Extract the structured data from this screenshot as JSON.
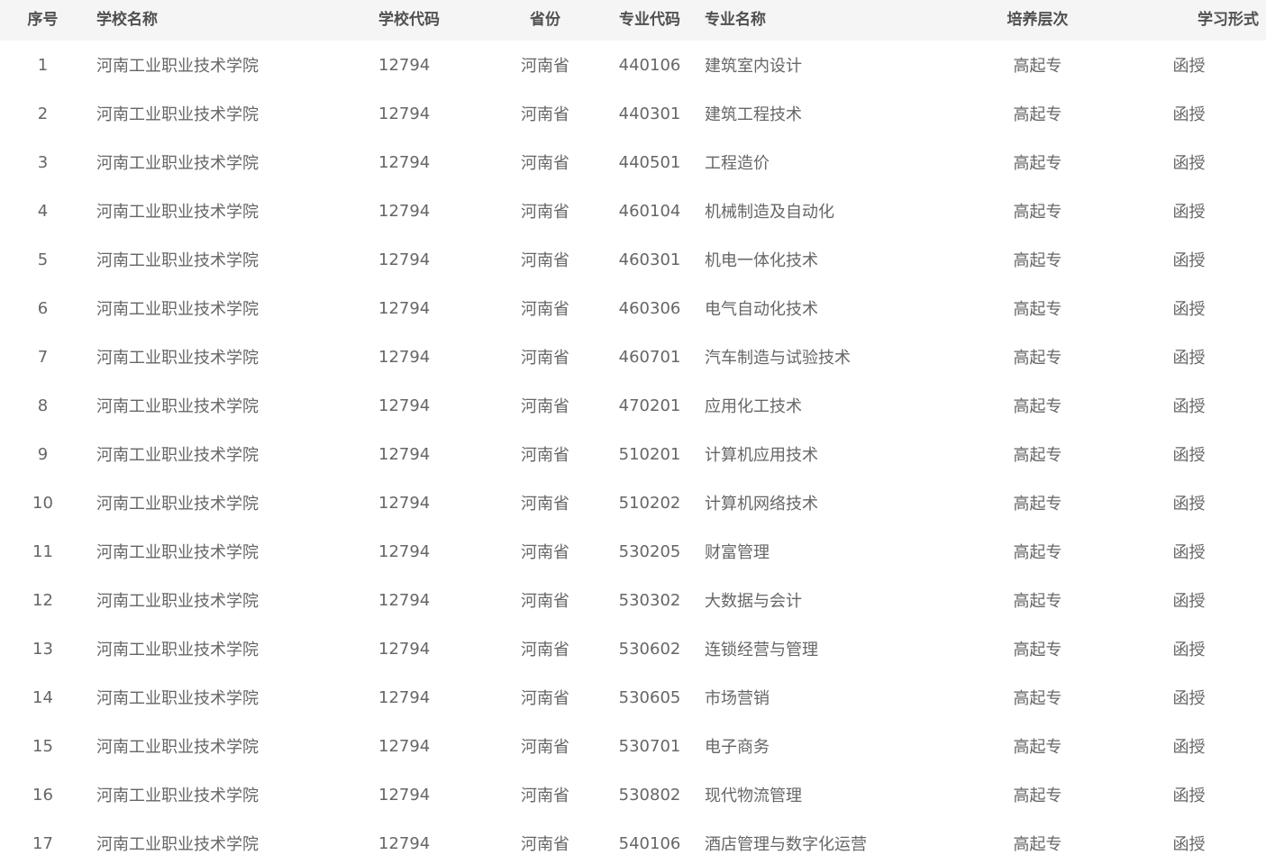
{
  "table": {
    "headers": {
      "index": "序号",
      "school_name": "学校名称",
      "school_code": "学校代码",
      "province": "省份",
      "major_code": "专业代码",
      "major_name": "专业名称",
      "level": "培养层次",
      "study_form": "学习形式"
    },
    "rows": [
      {
        "index": "1",
        "school_name": "河南工业职业技术学院",
        "school_code": "12794",
        "province": "河南省",
        "major_code": "440106",
        "major_name": "建筑室内设计",
        "level": "高起专",
        "study_form": "函授"
      },
      {
        "index": "2",
        "school_name": "河南工业职业技术学院",
        "school_code": "12794",
        "province": "河南省",
        "major_code": "440301",
        "major_name": "建筑工程技术",
        "level": "高起专",
        "study_form": "函授"
      },
      {
        "index": "3",
        "school_name": "河南工业职业技术学院",
        "school_code": "12794",
        "province": "河南省",
        "major_code": "440501",
        "major_name": "工程造价",
        "level": "高起专",
        "study_form": "函授"
      },
      {
        "index": "4",
        "school_name": "河南工业职业技术学院",
        "school_code": "12794",
        "province": "河南省",
        "major_code": "460104",
        "major_name": "机械制造及自动化",
        "level": "高起专",
        "study_form": "函授"
      },
      {
        "index": "5",
        "school_name": "河南工业职业技术学院",
        "school_code": "12794",
        "province": "河南省",
        "major_code": "460301",
        "major_name": "机电一体化技术",
        "level": "高起专",
        "study_form": "函授"
      },
      {
        "index": "6",
        "school_name": "河南工业职业技术学院",
        "school_code": "12794",
        "province": "河南省",
        "major_code": "460306",
        "major_name": "电气自动化技术",
        "level": "高起专",
        "study_form": "函授"
      },
      {
        "index": "7",
        "school_name": "河南工业职业技术学院",
        "school_code": "12794",
        "province": "河南省",
        "major_code": "460701",
        "major_name": "汽车制造与试验技术",
        "level": "高起专",
        "study_form": "函授"
      },
      {
        "index": "8",
        "school_name": "河南工业职业技术学院",
        "school_code": "12794",
        "province": "河南省",
        "major_code": "470201",
        "major_name": "应用化工技术",
        "level": "高起专",
        "study_form": "函授"
      },
      {
        "index": "9",
        "school_name": "河南工业职业技术学院",
        "school_code": "12794",
        "province": "河南省",
        "major_code": "510201",
        "major_name": "计算机应用技术",
        "level": "高起专",
        "study_form": "函授"
      },
      {
        "index": "10",
        "school_name": "河南工业职业技术学院",
        "school_code": "12794",
        "province": "河南省",
        "major_code": "510202",
        "major_name": "计算机网络技术",
        "level": "高起专",
        "study_form": "函授"
      },
      {
        "index": "11",
        "school_name": "河南工业职业技术学院",
        "school_code": "12794",
        "province": "河南省",
        "major_code": "530205",
        "major_name": "财富管理",
        "level": "高起专",
        "study_form": "函授"
      },
      {
        "index": "12",
        "school_name": "河南工业职业技术学院",
        "school_code": "12794",
        "province": "河南省",
        "major_code": "530302",
        "major_name": "大数据与会计",
        "level": "高起专",
        "study_form": "函授"
      },
      {
        "index": "13",
        "school_name": "河南工业职业技术学院",
        "school_code": "12794",
        "province": "河南省",
        "major_code": "530602",
        "major_name": "连锁经营与管理",
        "level": "高起专",
        "study_form": "函授"
      },
      {
        "index": "14",
        "school_name": "河南工业职业技术学院",
        "school_code": "12794",
        "province": "河南省",
        "major_code": "530605",
        "major_name": "市场营销",
        "level": "高起专",
        "study_form": "函授"
      },
      {
        "index": "15",
        "school_name": "河南工业职业技术学院",
        "school_code": "12794",
        "province": "河南省",
        "major_code": "530701",
        "major_name": "电子商务",
        "level": "高起专",
        "study_form": "函授"
      },
      {
        "index": "16",
        "school_name": "河南工业职业技术学院",
        "school_code": "12794",
        "province": "河南省",
        "major_code": "530802",
        "major_name": "现代物流管理",
        "level": "高起专",
        "study_form": "函授"
      },
      {
        "index": "17",
        "school_name": "河南工业职业技术学院",
        "school_code": "12794",
        "province": "河南省",
        "major_code": "540106",
        "major_name": "酒店管理与数字化运营",
        "level": "高起专",
        "study_form": "函授"
      }
    ]
  }
}
